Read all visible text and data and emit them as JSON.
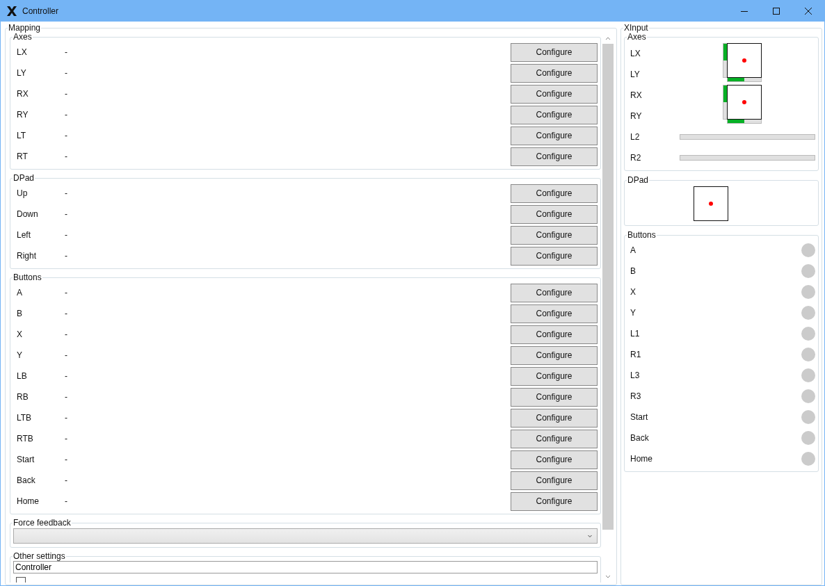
{
  "window": {
    "title": "Controller"
  },
  "mapping": {
    "title": "Mapping",
    "groups": [
      {
        "title": "Axes",
        "rows": [
          {
            "name": "LX",
            "value": "-",
            "button": "Configure"
          },
          {
            "name": "LY",
            "value": "-",
            "button": "Configure"
          },
          {
            "name": "RX",
            "value": "-",
            "button": "Configure"
          },
          {
            "name": "RY",
            "value": "-",
            "button": "Configure"
          },
          {
            "name": "LT",
            "value": "-",
            "button": "Configure"
          },
          {
            "name": "RT",
            "value": "-",
            "button": "Configure"
          }
        ]
      },
      {
        "title": "DPad",
        "rows": [
          {
            "name": "Up",
            "value": "-",
            "button": "Configure"
          },
          {
            "name": "Down",
            "value": "-",
            "button": "Configure"
          },
          {
            "name": "Left",
            "value": "-",
            "button": "Configure"
          },
          {
            "name": "Right",
            "value": "-",
            "button": "Configure"
          }
        ]
      },
      {
        "title": "Buttons",
        "rows": [
          {
            "name": "A",
            "value": "-",
            "button": "Configure"
          },
          {
            "name": "B",
            "value": "-",
            "button": "Configure"
          },
          {
            "name": "X",
            "value": "-",
            "button": "Configure"
          },
          {
            "name": "Y",
            "value": "-",
            "button": "Configure"
          },
          {
            "name": "LB",
            "value": "-",
            "button": "Configure"
          },
          {
            "name": "RB",
            "value": "-",
            "button": "Configure"
          },
          {
            "name": "LTB",
            "value": "-",
            "button": "Configure"
          },
          {
            "name": "RTB",
            "value": "-",
            "button": "Configure"
          },
          {
            "name": "Start",
            "value": "-",
            "button": "Configure"
          },
          {
            "name": "Back",
            "value": "-",
            "button": "Configure"
          },
          {
            "name": "Home",
            "value": "-",
            "button": "Configure"
          }
        ]
      }
    ],
    "force_feedback": {
      "title": "Force feedback"
    },
    "other_settings": {
      "title": "Other settings",
      "name_field": {
        "value": "Controller"
      },
      "checkbox": {
        "checked": false
      }
    }
  },
  "xinput": {
    "title": "XInput",
    "axes": {
      "title": "Axes",
      "sticks": [
        {
          "labels": [
            "LX",
            "LY"
          ],
          "x_bar": {
            "level": 0.5
          },
          "y_bar": {
            "level": 0.5
          }
        },
        {
          "labels": [
            "RX",
            "RY"
          ],
          "x_bar": {
            "level": 0.5
          },
          "y_bar": {
            "level": 0.5
          }
        }
      ],
      "triggers": [
        {
          "label": "L2",
          "level": 0
        },
        {
          "label": "R2",
          "level": 0
        }
      ]
    },
    "dpad": {
      "title": "DPad"
    },
    "buttons": {
      "title": "Buttons",
      "items": [
        {
          "label": "A",
          "pressed": false
        },
        {
          "label": "B",
          "pressed": false
        },
        {
          "label": "X",
          "pressed": false
        },
        {
          "label": "Y",
          "pressed": false
        },
        {
          "label": "L1",
          "pressed": false
        },
        {
          "label": "R1",
          "pressed": false
        },
        {
          "label": "L3",
          "pressed": false
        },
        {
          "label": "R3",
          "pressed": false
        },
        {
          "label": "Start",
          "pressed": false
        },
        {
          "label": "Back",
          "pressed": false
        },
        {
          "label": "Home",
          "pressed": false
        }
      ]
    }
  }
}
